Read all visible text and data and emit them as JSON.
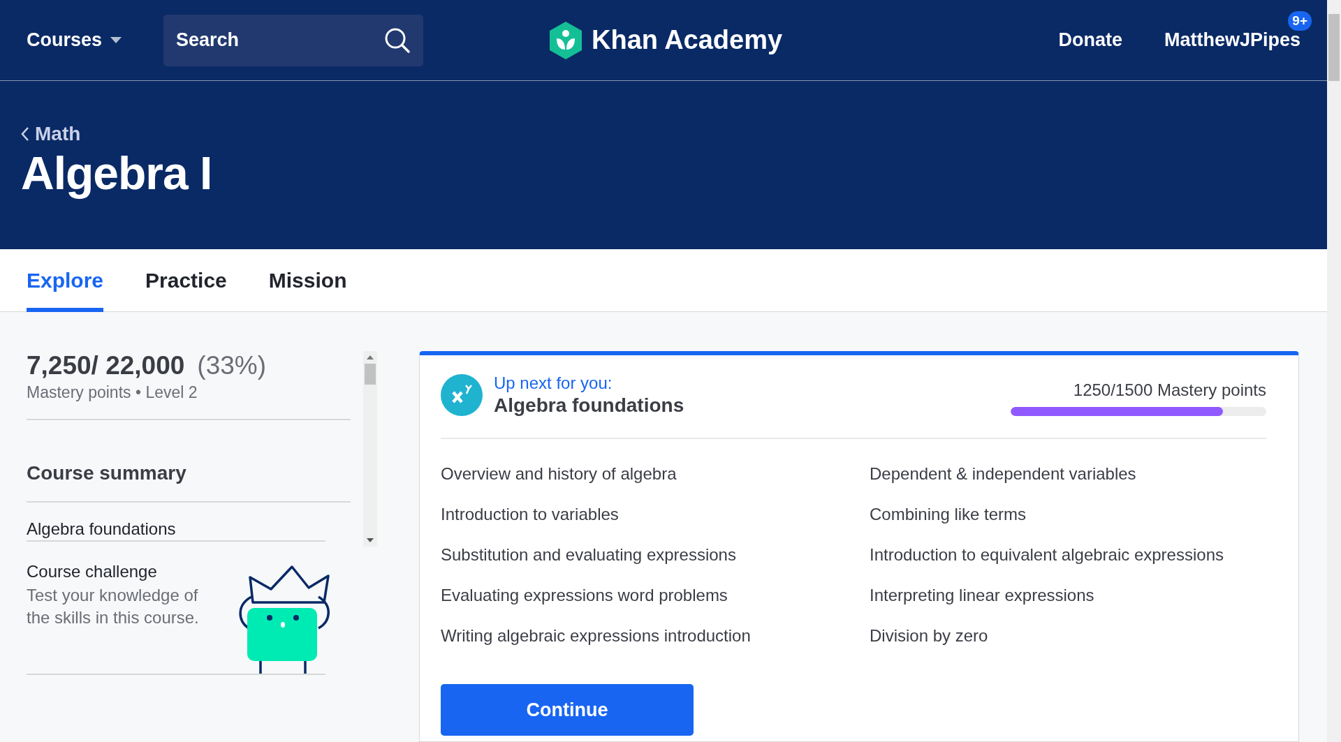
{
  "header": {
    "courses_menu": "Courses",
    "search": {
      "placeholder": "Search"
    },
    "logo_text": "Khan Academy",
    "donate": "Donate",
    "username": "MatthewJPipes",
    "notification_badge": "9+"
  },
  "hero": {
    "breadcrumb": "Math",
    "title": "Algebra I"
  },
  "tabs": [
    {
      "label": "Explore",
      "selected": true
    },
    {
      "label": "Practice",
      "selected": false
    },
    {
      "label": "Mission",
      "selected": false
    }
  ],
  "progress_summary": {
    "points": "7,250/ 22,000",
    "percent": "(33%)",
    "subtitle": "Mastery points • Level 2"
  },
  "course_summary": {
    "heading": "Course summary",
    "units": [
      "Algebra foundations"
    ]
  },
  "course_challenge": {
    "title": "Course challenge",
    "description": "Test your knowledge of the skills in this course."
  },
  "up_next": {
    "label": "Up next for you:",
    "unit": "Algebra foundations",
    "mastery": "1250/1500 Mastery points",
    "level": 0.83,
    "lessons": [
      "Overview and history of algebra",
      "Dependent & independent variables",
      "Introduction to variables",
      "Combining like terms",
      "Substitution and evaluating expressions",
      "Introduction to equivalent algebraic expressions",
      "Evaluating expressions word problems",
      "Interpreting linear expressions",
      "Writing algebraic expressions introduction",
      "Division by zero"
    ],
    "button": "Continue"
  }
}
